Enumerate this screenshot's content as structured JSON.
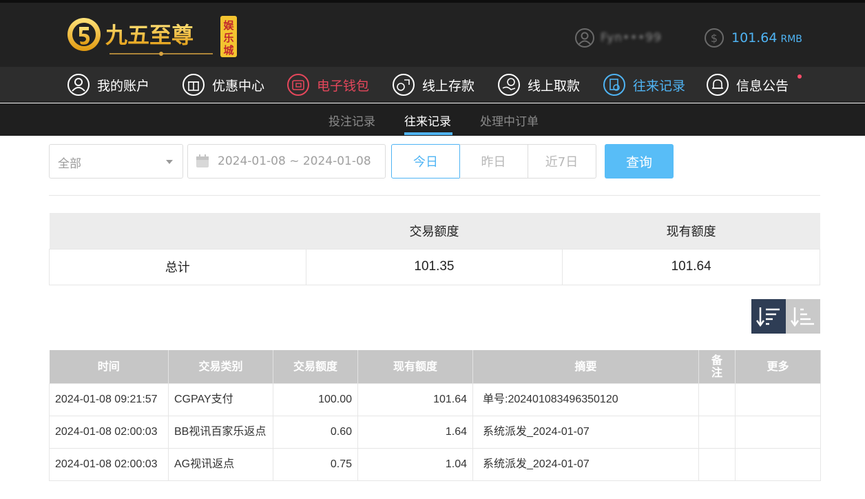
{
  "header": {
    "logo_text": "九五至尊",
    "logo_sub": "娱乐城",
    "user_name": "Fyn•••99",
    "balance": "101.64",
    "currency": "RMB"
  },
  "nav": {
    "items": [
      {
        "label": "我的账户",
        "icon": "user-icon"
      },
      {
        "label": "优惠中心",
        "icon": "gift-icon"
      },
      {
        "label": "电子钱包",
        "icon": "wallet-icon"
      },
      {
        "label": "线上存款",
        "icon": "deposit-icon"
      },
      {
        "label": "线上取款",
        "icon": "withdraw-icon"
      },
      {
        "label": "往来记录",
        "icon": "records-icon"
      },
      {
        "label": "信息公告",
        "icon": "bell-icon"
      }
    ]
  },
  "subnav": {
    "items": [
      "投注记录",
      "往来记录",
      "处理中订单"
    ],
    "active": "往来记录"
  },
  "filter": {
    "type_value": "全部",
    "date_range": "2024-01-08 ~ 2024-01-08",
    "today": "今日",
    "yesterday": "昨日",
    "last7": "近7日",
    "query": "查询"
  },
  "summary": {
    "headers": [
      "",
      "交易额度",
      "现有额度"
    ],
    "row_label": "总计",
    "trade_total": "101.35",
    "current_total": "101.64"
  },
  "table": {
    "headers": [
      "时间",
      "交易类别",
      "交易额度",
      "现有额度",
      "摘要",
      "备注",
      "更多"
    ],
    "rows": [
      {
        "time": "2024-01-08 09:21:57",
        "category": "CGPAY支付",
        "amount": "100.00",
        "balance": "101.64",
        "summary": "单号:202401083496350120",
        "note": "",
        "more": ""
      },
      {
        "time": "2024-01-08 02:00:03",
        "category": "BB视讯百家乐返点",
        "amount": "0.60",
        "balance": "1.64",
        "summary": "系统派发_2024-01-07",
        "note": "",
        "more": ""
      },
      {
        "time": "2024-01-08 02:00:03",
        "category": "AG视讯返点",
        "amount": "0.75",
        "balance": "1.04",
        "summary": "系统派发_2024-01-07",
        "note": "",
        "more": ""
      }
    ]
  },
  "colors": {
    "accent": "#4fb4f4",
    "wallet_red": "#e5475b",
    "header_bg": "#222222",
    "logo_gold": "#f2b21b"
  }
}
